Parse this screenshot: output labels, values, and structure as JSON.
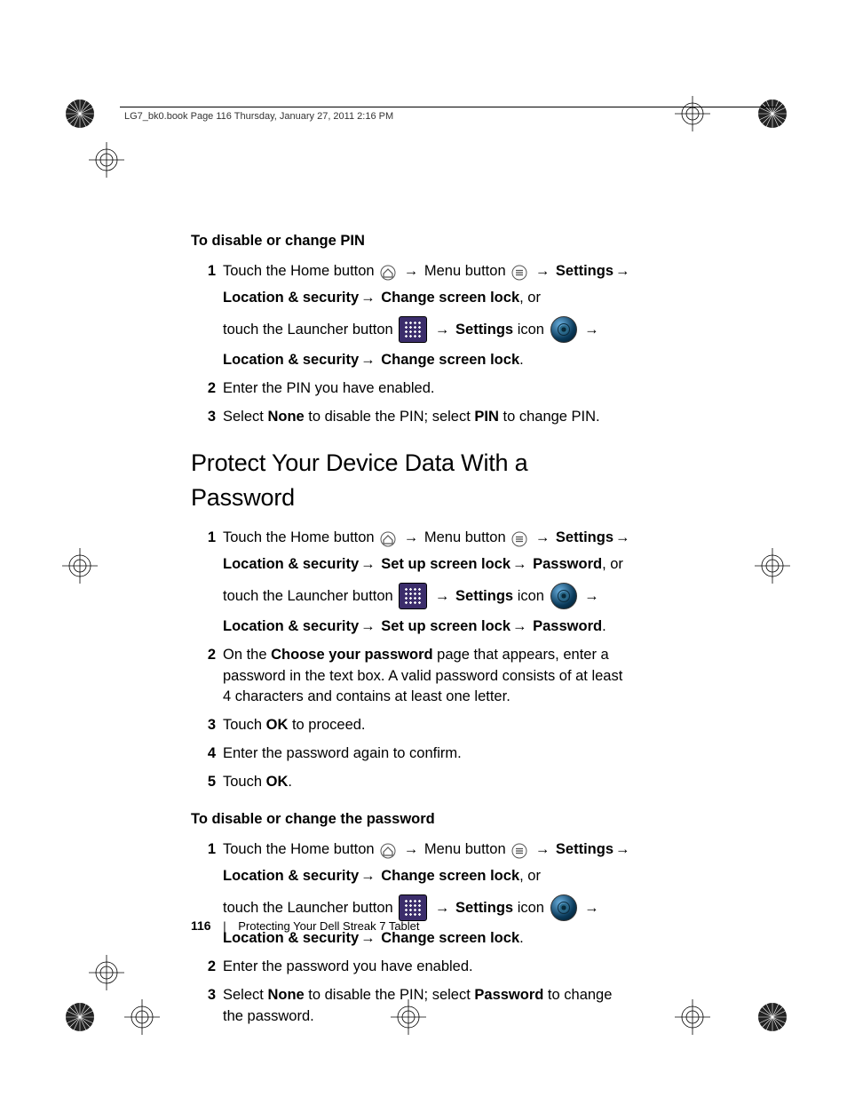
{
  "header": {
    "running": "LG7_bk0.book  Page 116  Thursday, January 27, 2011  2:16 PM"
  },
  "arrow": "→",
  "sectionA": {
    "subhead": "To disable or change PIN",
    "steps": [
      {
        "n": "1",
        "l1a": "Touch the Home button ",
        "l1b": " Menu button ",
        "l1c": " Settings",
        "l2a": "Location & security",
        "l2b": " Change screen lock",
        "l2c": ", or",
        "l3a": "touch the Launcher button ",
        "l3b": " Settings",
        "l3c": " icon ",
        "l4a": "Location & security",
        "l4b": " Change screen lock",
        "l4c": "."
      },
      {
        "n": "2",
        "t": "Enter the PIN you have enabled."
      },
      {
        "n": "3",
        "t1": "Select ",
        "b1": "None",
        "t2": " to disable the PIN; select ",
        "b2": "PIN",
        "t3": " to change PIN."
      }
    ]
  },
  "sectionB": {
    "title": "Protect Your Device Data With a Password",
    "steps": [
      {
        "n": "1",
        "l1a": "Touch the Home button ",
        "l1b": " Menu button ",
        "l1c": " Settings",
        "l2a": "Location & security",
        "l2b": " Set up screen lock",
        "l2c": " Password",
        "l2d": ", or",
        "l3a": "touch the Launcher button ",
        "l3b": " Settings",
        "l3c": " icon ",
        "l4a": "Location & security",
        "l4b": " Set up screen lock",
        "l4c": " Password",
        "l4d": "."
      },
      {
        "n": "2",
        "t1": "On the ",
        "b1": "Choose your password",
        "t2": " page that appears, enter a password in the text box. A valid password consists of at least 4 characters and contains at least one letter."
      },
      {
        "n": "3",
        "t1": "Touch ",
        "b1": "OK",
        "t2": " to proceed."
      },
      {
        "n": "4",
        "t": "Enter the password again to confirm."
      },
      {
        "n": "5",
        "t1": "Touch ",
        "b1": "OK",
        "t2": "."
      }
    ]
  },
  "sectionC": {
    "subhead": "To disable or change the password",
    "steps": [
      {
        "n": "1",
        "l1a": "Touch the Home button ",
        "l1b": " Menu button ",
        "l1c": " Settings",
        "l2a": "Location & security",
        "l2b": " Change screen lock",
        "l2c": ", or",
        "l3a": "touch the Launcher button ",
        "l3b": " Settings",
        "l3c": " icon ",
        "l4a": "Location & security",
        "l4b": " Change screen lock",
        "l4c": "."
      },
      {
        "n": "2",
        "t": "Enter the password you have enabled."
      },
      {
        "n": "3",
        "t1": "Select ",
        "b1": "None",
        "t2": " to disable the PIN; select ",
        "b2": "Password",
        "t3": " to change the password."
      }
    ]
  },
  "footer": {
    "page": "116",
    "chapter": "Protecting Your Dell Streak 7 Tablet"
  }
}
